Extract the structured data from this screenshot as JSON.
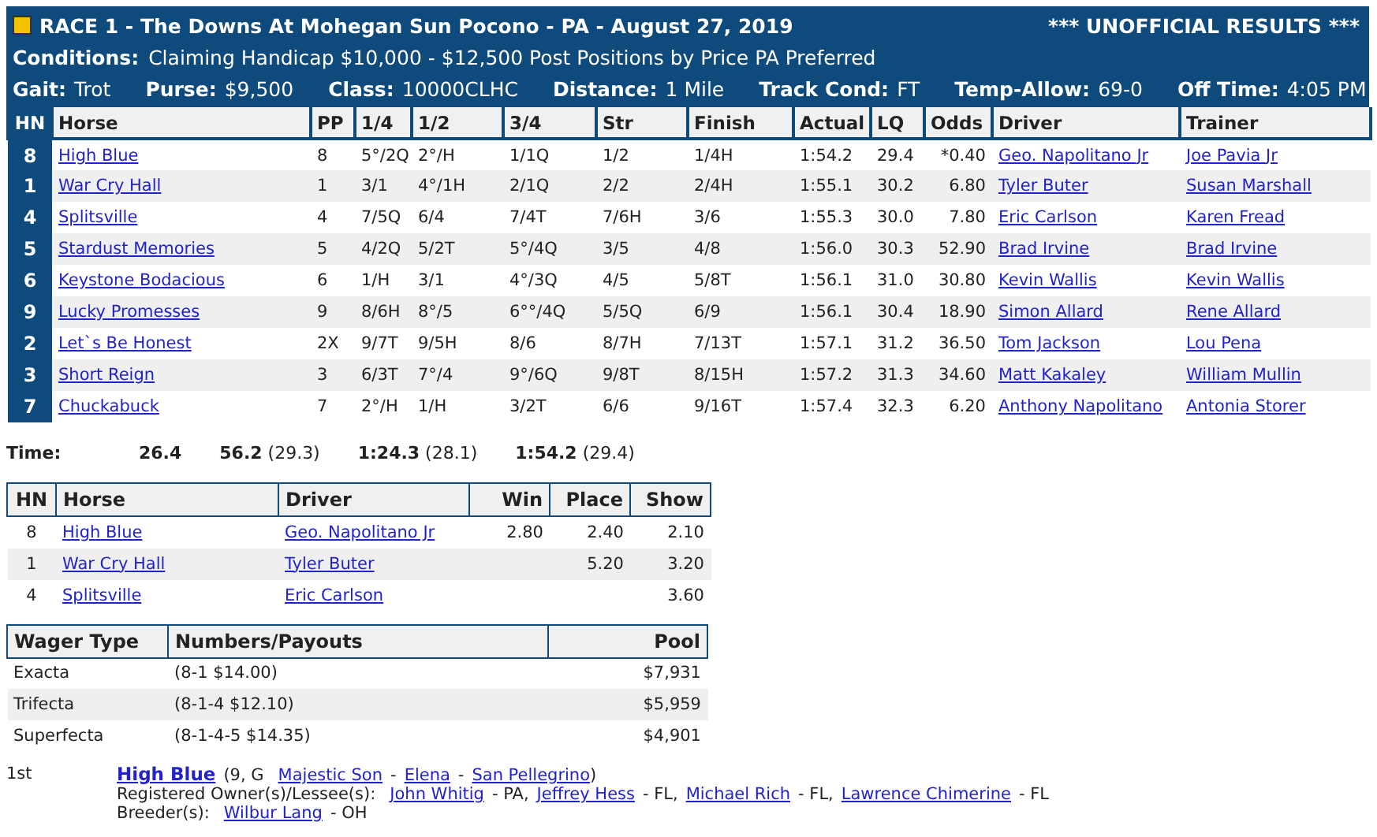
{
  "race": {
    "title": "RACE 1 - The Downs At Mohegan Sun Pocono - PA - August 27, 2019",
    "status": "*** UNOFFICIAL RESULTS ***"
  },
  "conditions": {
    "label": "Conditions:",
    "text": "Claiming Handicap $10,000 - $12,500 Post Positions by Price PA Preferred"
  },
  "details": [
    {
      "label": "Gait:",
      "value": "Trot"
    },
    {
      "label": "Purse:",
      "value": "$9,500"
    },
    {
      "label": "Class:",
      "value": "10000CLHC"
    },
    {
      "label": "Distance:",
      "value": "1 Mile"
    },
    {
      "label": "Track Cond:",
      "value": "FT"
    },
    {
      "label": "Temp-Allow:",
      "value": "69-0"
    },
    {
      "label": "Off Time:",
      "value": "4:05 PM"
    }
  ],
  "results": {
    "columns": [
      "HN",
      "Horse",
      "PP",
      "1/4",
      "1/2",
      "3/4",
      "Str",
      "Finish",
      "Actual",
      "LQ",
      "Odds",
      "Driver",
      "Trainer"
    ],
    "rows": [
      {
        "hn": "8",
        "horse": "High Blue",
        "pp": "8",
        "q1": "5°/2Q",
        "q2": "2°/H",
        "q3": "1/1Q",
        "str": "1/2",
        "finish": "1/4H",
        "actual": "1:54.2",
        "lq": "29.4",
        "odds": "*0.40",
        "driver": "Geo. Napolitano Jr",
        "trainer": "Joe Pavia Jr"
      },
      {
        "hn": "1",
        "horse": "War Cry Hall",
        "pp": "1",
        "q1": "3/1",
        "q2": "4°/1H",
        "q3": "2/1Q",
        "str": "2/2",
        "finish": "2/4H",
        "actual": "1:55.1",
        "lq": "30.2",
        "odds": "6.80",
        "driver": "Tyler Buter",
        "trainer": "Susan Marshall"
      },
      {
        "hn": "4",
        "horse": "Splitsville",
        "pp": "4",
        "q1": "7/5Q",
        "q2": "6/4",
        "q3": "7/4T",
        "str": "7/6H",
        "finish": "3/6",
        "actual": "1:55.3",
        "lq": "30.0",
        "odds": "7.80",
        "driver": "Eric Carlson",
        "trainer": "Karen Fread"
      },
      {
        "hn": "5",
        "horse": "Stardust Memories",
        "pp": "5",
        "q1": "4/2Q",
        "q2": "5/2T",
        "q3": "5°/4Q",
        "str": "3/5",
        "finish": "4/8",
        "actual": "1:56.0",
        "lq": "30.3",
        "odds": "52.90",
        "driver": "Brad Irvine",
        "trainer": "Brad Irvine"
      },
      {
        "hn": "6",
        "horse": "Keystone Bodacious",
        "pp": "6",
        "q1": "1/H",
        "q2": "3/1",
        "q3": "4°/3Q",
        "str": "4/5",
        "finish": "5/8T",
        "actual": "1:56.1",
        "lq": "31.0",
        "odds": "30.80",
        "driver": "Kevin Wallis",
        "trainer": "Kevin Wallis"
      },
      {
        "hn": "9",
        "horse": "Lucky Promesses",
        "pp": "9",
        "q1": "8/6H",
        "q2": "8°/5",
        "q3": "6°°/4Q",
        "str": "5/5Q",
        "finish": "6/9",
        "actual": "1:56.1",
        "lq": "30.4",
        "odds": "18.90",
        "driver": "Simon Allard",
        "trainer": "Rene Allard"
      },
      {
        "hn": "2",
        "horse": "Let`s Be Honest",
        "pp": "2X",
        "q1": "9/7T",
        "q2": "9/5H",
        "q3": "8/6",
        "str": "8/7H",
        "finish": "7/13T",
        "actual": "1:57.1",
        "lq": "31.2",
        "odds": "36.50",
        "driver": "Tom Jackson",
        "trainer": "Lou Pena"
      },
      {
        "hn": "3",
        "horse": "Short Reign",
        "pp": "3",
        "q1": "6/3T",
        "q2": "7°/4",
        "q3": "9°/6Q",
        "str": "9/8T",
        "finish": "8/15H",
        "actual": "1:57.2",
        "lq": "31.3",
        "odds": "34.60",
        "driver": "Matt Kakaley",
        "trainer": "William Mullin"
      },
      {
        "hn": "7",
        "horse": "Chuckabuck",
        "pp": "7",
        "q1": "2°/H",
        "q2": "1/H",
        "q3": "3/2T",
        "str": "6/6",
        "finish": "9/16T",
        "actual": "1:57.4",
        "lq": "32.3",
        "odds": "6.20",
        "driver": "Anthony Napolitano",
        "trainer": "Antonia Storer"
      }
    ]
  },
  "times": {
    "label": "Time:",
    "splits": [
      {
        "time": "26.4"
      },
      {
        "time": "56.2",
        "quarter": "(29.3)"
      },
      {
        "time": "1:24.3",
        "quarter": "(28.1)"
      },
      {
        "time": "1:54.2",
        "quarter": "(29.4)"
      }
    ]
  },
  "payouts": {
    "columns": [
      "HN",
      "Horse",
      "Driver",
      "Win",
      "Place",
      "Show"
    ],
    "rows": [
      {
        "hn": "8",
        "horse": "High Blue",
        "driver": "Geo. Napolitano Jr",
        "win": "2.80",
        "place": "2.40",
        "show": "2.10"
      },
      {
        "hn": "1",
        "horse": "War Cry Hall",
        "driver": "Tyler Buter",
        "place": "5.20",
        "show": "3.20"
      },
      {
        "hn": "4",
        "horse": "Splitsville",
        "driver": "Eric Carlson",
        "show": "3.60"
      }
    ]
  },
  "wagers": {
    "columns": [
      "Wager Type",
      "Numbers/Payouts",
      "Pool"
    ],
    "rows": [
      {
        "type": "Exacta",
        "payout": "(8-1 $14.00)",
        "pool": "$7,931"
      },
      {
        "type": "Trifecta",
        "payout": "(8-1-4 $12.10)",
        "pool": "$5,959"
      },
      {
        "type": "Superfecta",
        "payout": "(8-1-4-5 $14.35)",
        "pool": "$4,901"
      }
    ]
  },
  "winner": {
    "place": "1st",
    "horse": "High Blue",
    "age_sex": "(9, G",
    "sire": "Majestic Son",
    "dam": "Elena",
    "damsire": "San Pellegrino",
    "separator": "-",
    "close": ")",
    "owners_label": "Registered Owner(s)/Lessee(s):",
    "owners": [
      {
        "name": "John Whitig",
        "state": "- PA,"
      },
      {
        "name": "Jeffrey Hess",
        "state": "- FL,"
      },
      {
        "name": "Michael Rich",
        "state": "- FL,"
      },
      {
        "name": "Lawrence Chimerine",
        "state": "- FL"
      }
    ],
    "breeders_label": "Breeder(s):",
    "breeders": [
      {
        "name": "Wilbur Lang",
        "state": "- OH"
      }
    ]
  }
}
